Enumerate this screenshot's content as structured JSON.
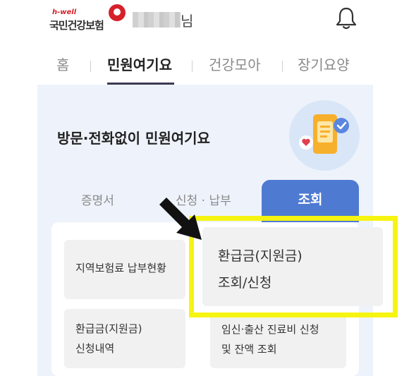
{
  "header": {
    "logo_brand": "h-well",
    "logo_name": "국민건강보험",
    "user_suffix": "님"
  },
  "nav": {
    "tabs": [
      {
        "label": "홈",
        "active": false
      },
      {
        "label": "민원여기요",
        "active": true
      },
      {
        "label": "건강모아",
        "active": false
      },
      {
        "label": "장기요양",
        "active": false
      }
    ]
  },
  "main": {
    "title": "방문·전화없이 민원여기요",
    "sub_tabs": [
      {
        "label": "증명서",
        "active": false
      },
      {
        "label": "신청 · 납부",
        "active": false
      },
      {
        "label": "조회",
        "active": true
      }
    ],
    "tiles": [
      {
        "lines": [
          "지역보험료 납부현황"
        ]
      },
      {
        "lines": [
          "환급금(지원금)",
          "조회/신청"
        ],
        "highlighted": true
      },
      {
        "lines": [
          "환급금(지원금)",
          "신청내역"
        ]
      },
      {
        "lines": [
          "임신·출산 진료비 신청",
          "및 잔액 조회"
        ]
      }
    ]
  },
  "colors": {
    "accent": "#4f7ad2",
    "highlight": "#f6f411",
    "brand": "#d6202a"
  }
}
